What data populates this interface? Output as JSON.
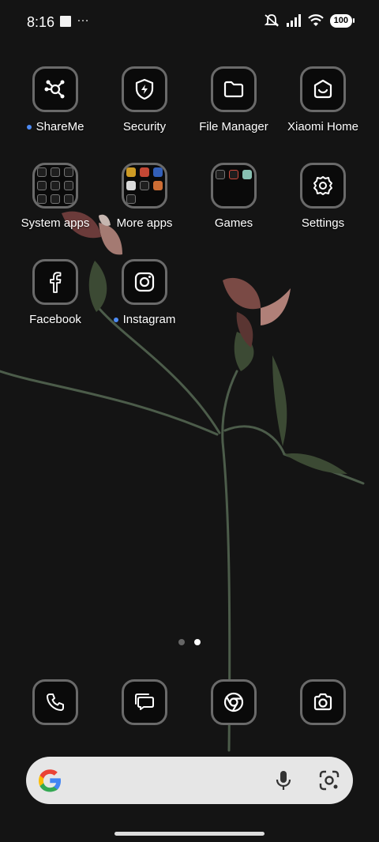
{
  "status_bar": {
    "time": "8:16",
    "more_indicator": "…",
    "battery": "100",
    "icons": [
      "notification-square-icon",
      "ring-muted-icon",
      "signal-icon",
      "wifi-icon",
      "battery-icon"
    ]
  },
  "apps": [
    {
      "label": "ShareMe",
      "icon": "shareme-icon",
      "new_dot": true
    },
    {
      "label": "Security",
      "icon": "shield-icon",
      "new_dot": false
    },
    {
      "label": "File Manager",
      "icon": "folder-icon",
      "new_dot": false
    },
    {
      "label": "Xiaomi Home",
      "icon": "home-icon",
      "new_dot": false
    },
    {
      "label": "System apps",
      "icon": "folder-grid-icon",
      "new_dot": false
    },
    {
      "label": "More apps",
      "icon": "folder-grid-icon",
      "new_dot": false
    },
    {
      "label": "Games",
      "icon": "folder-grid-icon",
      "new_dot": false
    },
    {
      "label": "Settings",
      "icon": "gear-icon",
      "new_dot": false
    },
    {
      "label": "Facebook",
      "icon": "facebook-icon",
      "new_dot": false
    },
    {
      "label": "Instagram",
      "icon": "instagram-icon",
      "new_dot": true
    }
  ],
  "page_indicator": {
    "pages": 2,
    "current": 2
  },
  "dock": [
    {
      "icon": "phone-icon"
    },
    {
      "icon": "messages-icon"
    },
    {
      "icon": "chrome-icon"
    },
    {
      "icon": "camera-icon"
    }
  ],
  "search_bar": {
    "icons": [
      "google-g-icon",
      "microphone-icon",
      "google-lens-icon"
    ]
  },
  "colors": {
    "background": "#141414",
    "icon_border": "#6a6a6a",
    "new_dot": "#4d8bf5",
    "search_bar": "#e6e6e6"
  }
}
